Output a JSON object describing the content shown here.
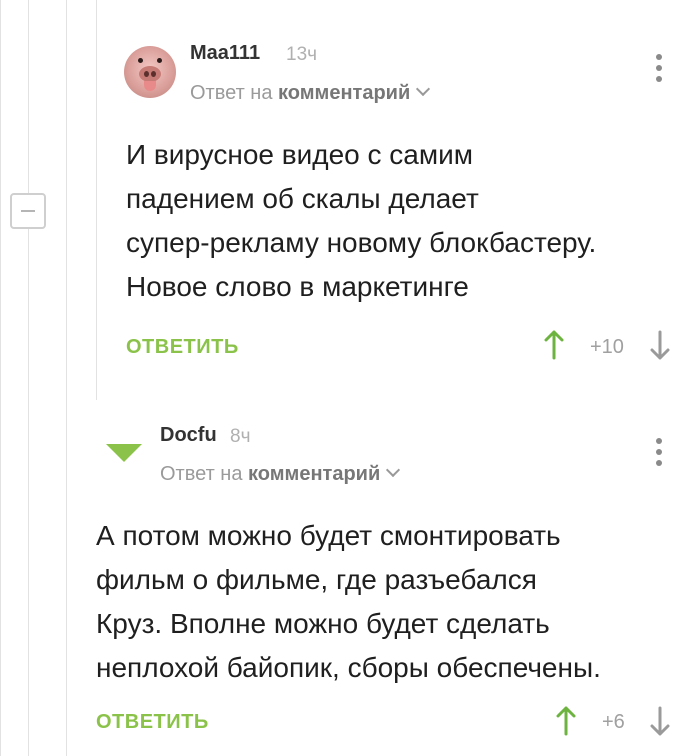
{
  "comments": [
    {
      "username": "Maa111",
      "time": "13ч",
      "reply_prefix": "Ответ на ",
      "reply_target": "комментарий",
      "text_lines": [
        "И вирусное видео с самим",
        "падением об скалы делает",
        "супер-рекламу новому блокбастеру.",
        "Новое слово в маркетинге"
      ],
      "reply_label": "ОТВЕТИТЬ",
      "rating": "+10"
    },
    {
      "username": "Docfu",
      "time": "8ч",
      "reply_prefix": "Ответ на ",
      "reply_target": "комментарий",
      "text_lines": [
        "А потом можно будет смонтировать",
        "фильм о фильме, где разъебался",
        "Круз. Вполне можно будет сделать",
        "неплохой байопик, сборы обеспечены."
      ],
      "reply_label": "ОТВЕТИТЬ",
      "rating": "+6"
    }
  ],
  "icons": {
    "upvote": "arrow-up-icon",
    "downvote": "arrow-down-icon",
    "menu": "kebab-menu-icon",
    "collapse": "collapse-minus-icon"
  },
  "colors": {
    "accent_green": "#8bc34a",
    "upvote_green": "#6cb33f",
    "muted": "#9a9a9a"
  }
}
